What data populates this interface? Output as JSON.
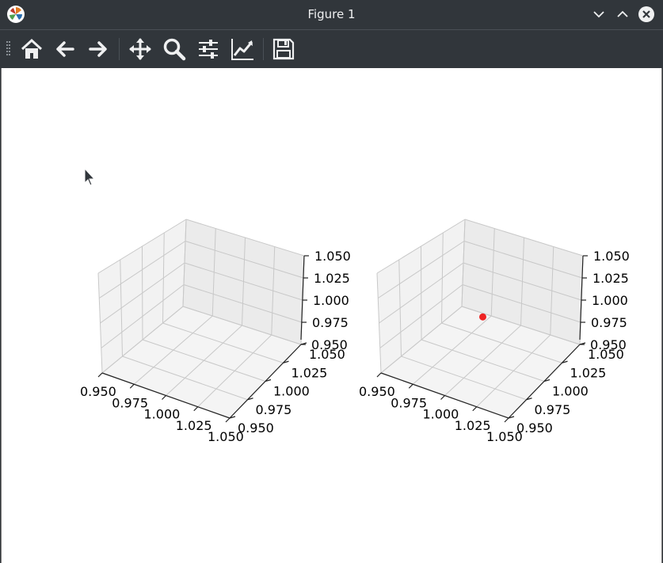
{
  "window": {
    "title": "Figure 1",
    "icons": [
      "matplotlib-logo-icon",
      "chevron-down-icon",
      "chevron-up-icon",
      "close-icon"
    ]
  },
  "toolbar": {
    "tools": [
      {
        "name": "home",
        "icon": "home-icon"
      },
      {
        "name": "back",
        "icon": "arrow-left-icon"
      },
      {
        "name": "forward",
        "icon": "arrow-right-icon"
      },
      {
        "name": "pan",
        "icon": "move-icon"
      },
      {
        "name": "zoom",
        "icon": "magnifier-icon"
      },
      {
        "name": "configure-subplots",
        "icon": "sliders-icon"
      },
      {
        "name": "edit-axes",
        "icon": "line-chart-icon"
      },
      {
        "name": "save",
        "icon": "floppy-disk-icon"
      }
    ]
  },
  "chart_data": [
    {
      "type": "scatter",
      "projection": "3d",
      "x": [],
      "y": [],
      "z": [],
      "xlim": [
        0.95,
        1.05
      ],
      "ylim": [
        0.95,
        1.05
      ],
      "zlim": [
        0.95,
        1.05
      ],
      "x_ticks": [
        "0.950",
        "0.975",
        "1.000",
        "1.025",
        "1.050"
      ],
      "y_ticks": [
        "0.950",
        "0.975",
        "1.000",
        "1.025",
        "1.050"
      ],
      "z_ticks": [
        "0.950",
        "0.975",
        "1.000",
        "1.025",
        "1.050"
      ],
      "grid": true
    },
    {
      "type": "scatter",
      "projection": "3d",
      "x": [
        1.0
      ],
      "y": [
        1.0
      ],
      "z": [
        1.0
      ],
      "point_color": "#ee2222",
      "xlim": [
        0.95,
        1.05
      ],
      "ylim": [
        0.95,
        1.05
      ],
      "zlim": [
        0.95,
        1.05
      ],
      "x_ticks": [
        "0.950",
        "0.975",
        "1.000",
        "1.025",
        "1.050"
      ],
      "y_ticks": [
        "0.950",
        "0.975",
        "1.000",
        "1.025",
        "1.050"
      ],
      "z_ticks": [
        "0.950",
        "0.975",
        "1.000",
        "1.025",
        "1.050"
      ],
      "grid": true
    }
  ]
}
